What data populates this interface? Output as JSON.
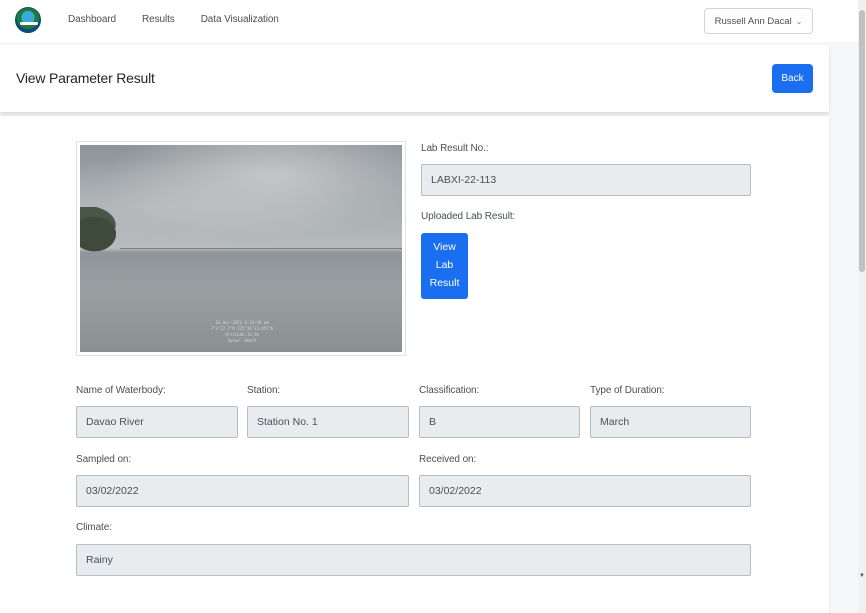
{
  "nav": {
    "links": [
      "Dashboard",
      "Results",
      "Data Visualization"
    ],
    "user_name": "Russell Ann Dacal"
  },
  "header": {
    "title": "View Parameter Result",
    "back_label": "Back"
  },
  "photo": {
    "stamp_lines": [
      "16-Apr-2022 9:19:48 am",
      "7°3'27.7\"N 125°36'33.457\"E",
      "Altitude:10.2m",
      "Speed: 0km/h"
    ]
  },
  "lab": {
    "result_no_label": "Lab Result No.:",
    "result_no_value": "LABXI-22-113",
    "uploaded_label": "Uploaded Lab Result:",
    "view_button": [
      "View",
      "Lab",
      "Result"
    ]
  },
  "fields": {
    "waterbody_label": "Name of Waterbody:",
    "waterbody_value": "Davao River",
    "station_label": "Station:",
    "station_value": "Station No. 1",
    "classification_label": "Classification:",
    "classification_value": "B",
    "duration_label": "Type of Duration:",
    "duration_value": "March",
    "sampled_label": "Sampled on:",
    "sampled_value": "03/02/2022",
    "received_label": "Received on:",
    "received_value": "03/02/2022",
    "climate_label": "Climate:",
    "climate_value": "Rainy"
  },
  "colors": {
    "primary": "#1a6ef0",
    "field_bg": "#e9ecef"
  },
  "icons": {
    "logo": "agency-logo-icon",
    "user_chevron": "chevron-down-icon",
    "scroll_down": "scroll-down-arrow-icon"
  }
}
